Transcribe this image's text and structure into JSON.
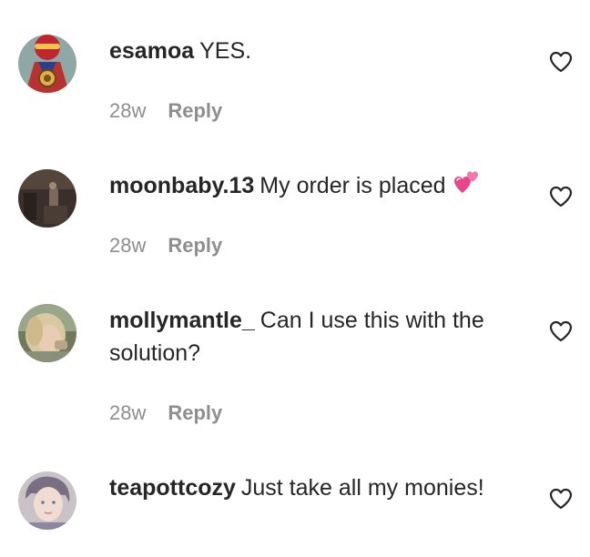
{
  "comments": [
    {
      "username": "esamoa",
      "text": "YES.",
      "time": "28w",
      "reply_label": "Reply",
      "avatar_icon": "superhero-avatar",
      "like_icon": "heart-outline-icon"
    },
    {
      "username": "moonbaby.13",
      "text": "My order is placed",
      "emoji": "two-hearts-emoji",
      "time": "28w",
      "reply_label": "Reply",
      "avatar_icon": "dark-photo-avatar",
      "like_icon": "heart-outline-icon"
    },
    {
      "username": "mollymantle_",
      "text": "Can I use this with the solution?",
      "time": "28w",
      "reply_label": "Reply",
      "avatar_icon": "blonde-person-avatar",
      "like_icon": "heart-outline-icon"
    },
    {
      "username": "teapottcozy",
      "text": "Just take all my monies!",
      "avatar_icon": "person-avatar",
      "like_icon": "heart-outline-icon"
    }
  ],
  "colors": {
    "text": "#262626",
    "muted": "#8e8e8e",
    "background": "#ffffff",
    "emoji_pink": "#e8458b"
  }
}
